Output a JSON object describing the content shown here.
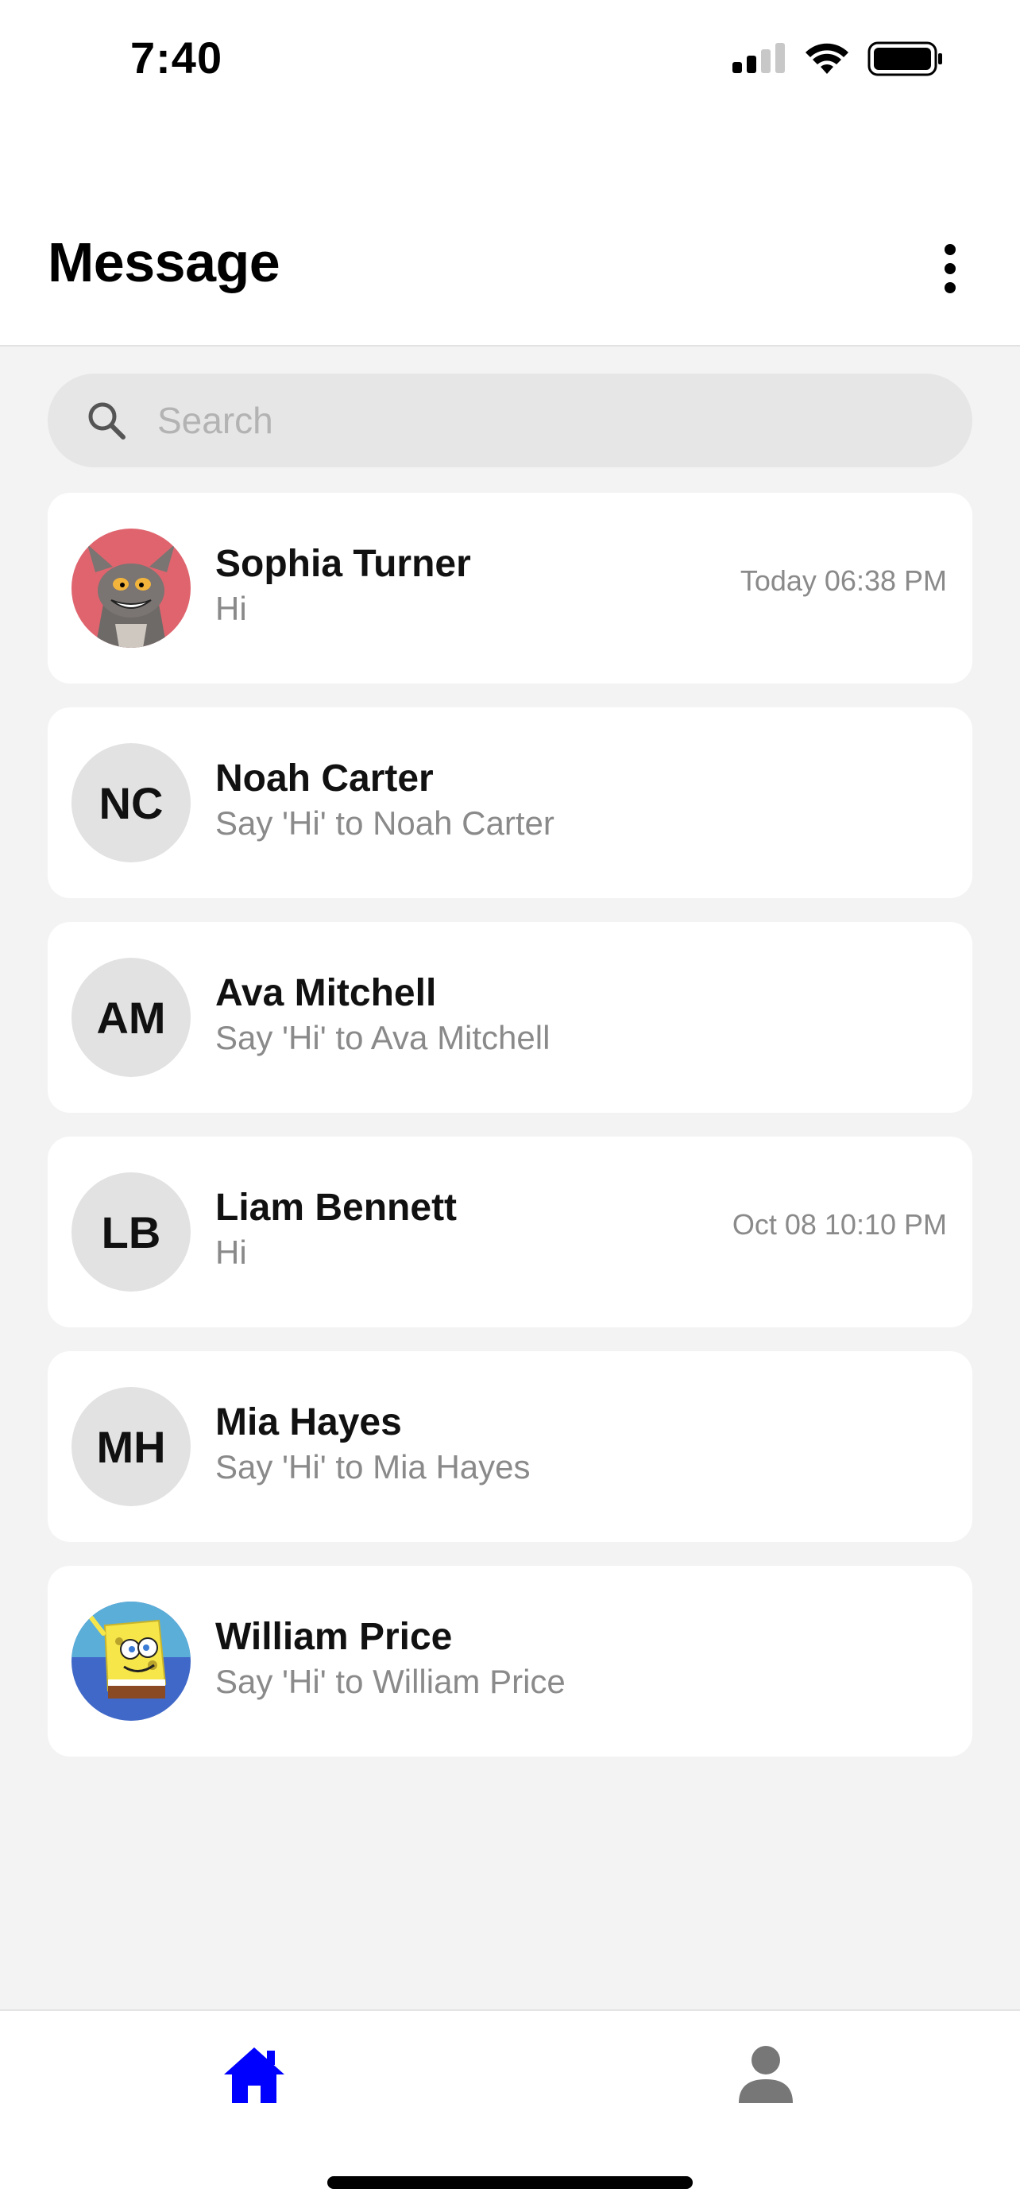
{
  "status_bar": {
    "time": "7:40",
    "icons": [
      "cellular-signal-icon",
      "wifi-icon",
      "battery-icon"
    ]
  },
  "header": {
    "title": "Message",
    "menu_icon": "more-vertical-icon"
  },
  "search": {
    "placeholder": "Search",
    "value": "",
    "icon": "search-icon"
  },
  "conversations": [
    {
      "name": "Sophia Turner",
      "preview": "Hi",
      "time": "Today 06:38 PM",
      "avatar": "cartoon-cat-avatar",
      "initials": ""
    },
    {
      "name": "Noah Carter",
      "preview": "Say 'Hi' to Noah Carter",
      "time": "",
      "avatar": "initials",
      "initials": "NC"
    },
    {
      "name": "Ava Mitchell",
      "preview": "Say 'Hi' to Ava Mitchell",
      "time": "",
      "avatar": "initials",
      "initials": "AM"
    },
    {
      "name": "Liam Bennett",
      "preview": "Hi",
      "time": "Oct 08 10:10 PM",
      "avatar": "initials",
      "initials": "LB"
    },
    {
      "name": "Mia Hayes",
      "preview": "Say 'Hi' to Mia Hayes",
      "time": "",
      "avatar": "initials",
      "initials": "MH"
    },
    {
      "name": "William Price",
      "preview": "Say 'Hi' to William Price",
      "time": "",
      "avatar": "cartoon-sponge-avatar",
      "initials": ""
    }
  ],
  "tab_bar": {
    "tabs": [
      {
        "icon": "home-icon",
        "active": true
      },
      {
        "icon": "person-icon",
        "active": false
      }
    ]
  },
  "colors": {
    "accent": "#0000ff",
    "background": "#f3f3f3",
    "card": "#ffffff",
    "muted_text": "#8a8a8a",
    "avatar_bg": "#e2e2e2",
    "inactive_icon": "#777777"
  }
}
